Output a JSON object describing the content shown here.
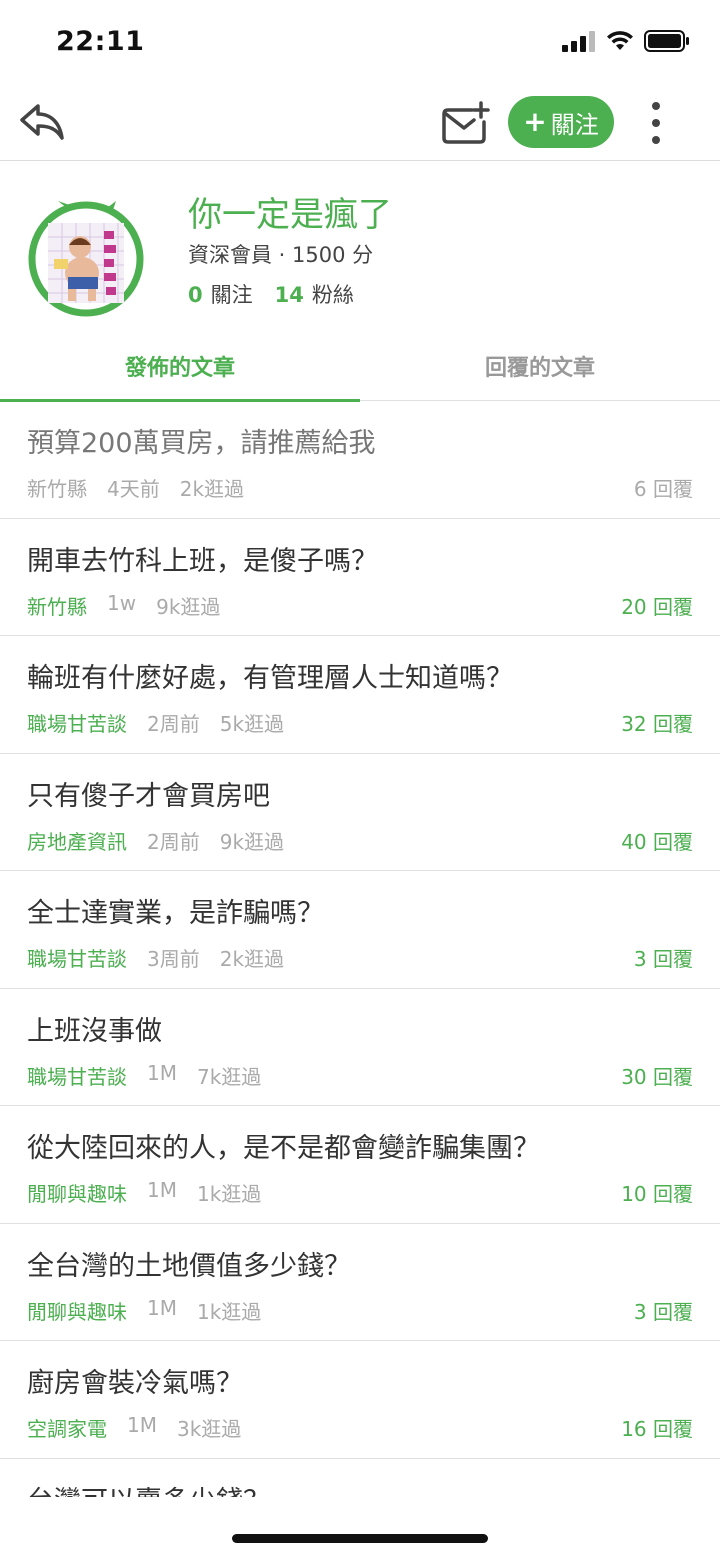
{
  "status": {
    "time": "22:11"
  },
  "nav": {
    "follow_label": "關注"
  },
  "profile": {
    "name": "你一定是瘋了",
    "meta": "資深會員 · 1500 分",
    "following_count": "0",
    "following_label": "關注",
    "followers_count": "14",
    "followers_label": "粉絲"
  },
  "tabs": [
    {
      "label": "發佈的文章"
    },
    {
      "label": "回覆的文章"
    }
  ],
  "posts": [
    {
      "title": "預算200萬買房，請推薦給我",
      "category": "新竹縣",
      "time": "4天前",
      "views": "2k逛過",
      "replies": "6 回覆"
    },
    {
      "title": "開車去竹科上班，是傻子嗎？",
      "category": "新竹縣",
      "time": "1w",
      "views": "9k逛過",
      "replies": "20 回覆"
    },
    {
      "title": "輪班有什麼好處，有管理層人士知道嗎？",
      "category": "職場甘苦談",
      "time": "2周前",
      "views": "5k逛過",
      "replies": "32 回覆"
    },
    {
      "title": "只有傻子才會買房吧",
      "category": "房地產資訊",
      "time": "2周前",
      "views": "9k逛過",
      "replies": "40 回覆"
    },
    {
      "title": "全士達實業，是詐騙嗎？",
      "category": "職場甘苦談",
      "time": "3周前",
      "views": "2k逛過",
      "replies": "3 回覆"
    },
    {
      "title": "上班沒事做",
      "category": "職場甘苦談",
      "time": "1M",
      "views": "7k逛過",
      "replies": "30 回覆"
    },
    {
      "title": "從大陸回來的人，是不是都會變詐騙集團？",
      "category": "閒聊與趣味",
      "time": "1M",
      "views": "1k逛過",
      "replies": "10 回覆"
    },
    {
      "title": "全台灣的土地價值多少錢？",
      "category": "閒聊與趣味",
      "time": "1M",
      "views": "1k逛過",
      "replies": "3 回覆"
    },
    {
      "title": "廚房會裝冷氣嗎？",
      "category": "空調家電",
      "time": "1M",
      "views": "3k逛過",
      "replies": "16 回覆"
    },
    {
      "title": "台灣可以賣多少錢？",
      "category": "",
      "time": "",
      "views": "",
      "replies": ""
    }
  ],
  "icons": {
    "back": "reply-arrow-icon",
    "mail": "mail-plus-icon",
    "more": "more-vertical-icon"
  },
  "colors": {
    "accent": "#4caf50"
  }
}
